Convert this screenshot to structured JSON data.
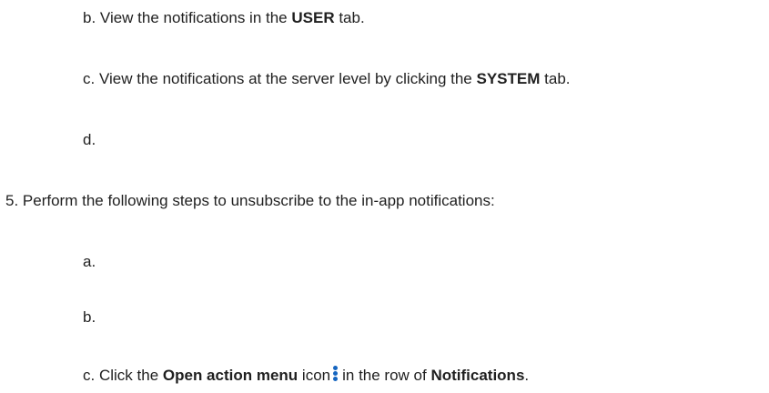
{
  "steps": {
    "step4b": {
      "marker": "b.",
      "before": "View the notifications in the",
      "bold": "USER",
      "after": "tab."
    },
    "step4c": {
      "marker": "c.",
      "before": "View the notifications at the server level by clicking the",
      "bold": "SYSTEM",
      "after": "tab."
    },
    "step4d": {
      "marker": "d."
    },
    "step5": {
      "marker": "5.",
      "text": "Perform the following steps to unsubscribe to the in-app notifications:"
    },
    "step5a": {
      "marker": "a."
    },
    "step5b": {
      "marker": "b."
    },
    "step5c": {
      "marker": "c.",
      "before": "Click the",
      "bold1": "Open action menu",
      "middle1": "icon",
      "icon": "kebab-menu-icon",
      "middle2": "in the row of",
      "bold2": "Notifications",
      "after": "."
    }
  },
  "colors": {
    "text": "#1f1f1f",
    "icon": "#1565c0"
  }
}
